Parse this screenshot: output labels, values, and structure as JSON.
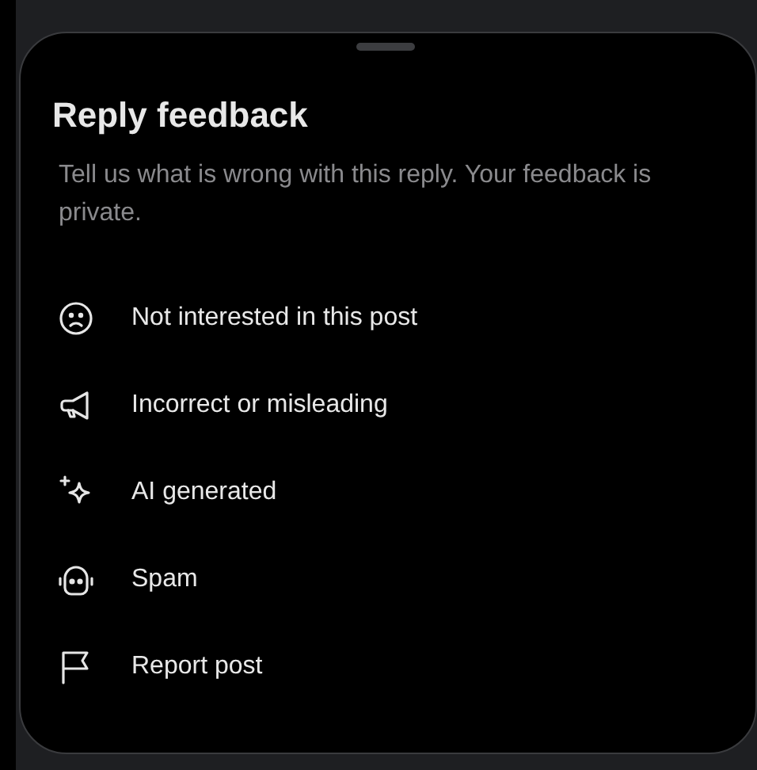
{
  "sheet": {
    "title": "Reply feedback",
    "description": "Tell us what is wrong with this reply. Your feedback is private."
  },
  "options": [
    {
      "kind": "sad",
      "label": "Not interested in this post"
    },
    {
      "kind": "megaphone",
      "label": "Incorrect or misleading"
    },
    {
      "kind": "sparkle",
      "label": "AI generated"
    },
    {
      "kind": "bot",
      "label": "Spam"
    },
    {
      "kind": "flag",
      "label": "Report post"
    }
  ]
}
